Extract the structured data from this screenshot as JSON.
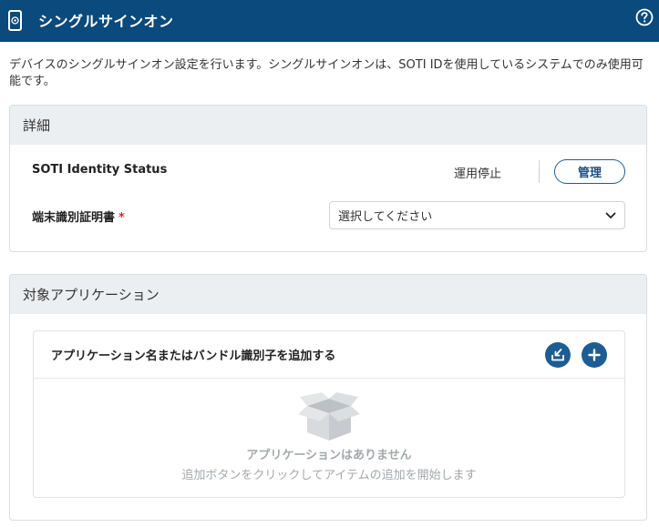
{
  "header": {
    "title": "シングルサインオン",
    "app_icon": "phone-sso-icon",
    "help_icon": "help-circle-icon"
  },
  "description": "デバイスのシングルサインオン設定を行います。シングルサインオンは、SOTI IDを使用しているシステムでのみ使用可能です。",
  "details": {
    "heading": "詳細",
    "identity_label": "SOTI Identity Status",
    "identity_status": "運用停止",
    "manage_button": "管理",
    "cert_label": "端末識別証明書",
    "required_mark": "*",
    "cert_select_value": "選択してください"
  },
  "apps": {
    "heading": "対象アプリケーション",
    "list_header": "アプリケーション名またはバンドル識別子を追加する",
    "import_icon": "import-tray-icon",
    "add_icon": "plus-icon",
    "empty_title": "アプリケーションはありません",
    "empty_subtitle": "追加ボタンをクリックしてアイテムの追加を開始します"
  },
  "colors": {
    "header_bg": "#0a4a7c",
    "accent": "#1d5d93",
    "required": "#d32f2f"
  }
}
